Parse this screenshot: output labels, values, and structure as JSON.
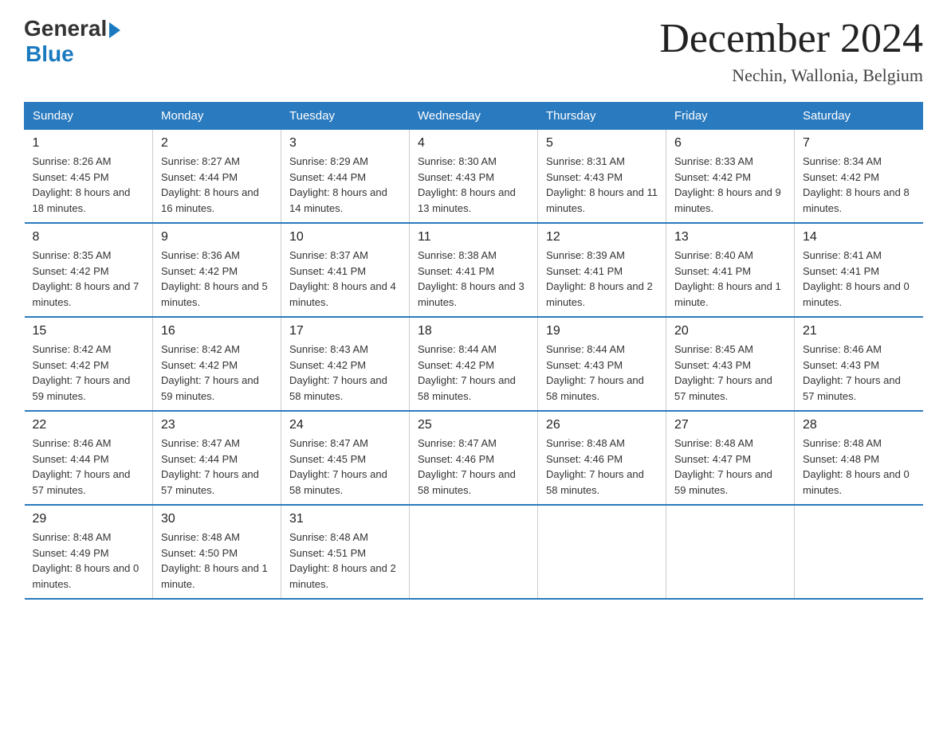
{
  "logo": {
    "general": "General",
    "blue": "Blue"
  },
  "title": {
    "month": "December 2024",
    "location": "Nechin, Wallonia, Belgium"
  },
  "days_of_week": [
    "Sunday",
    "Monday",
    "Tuesday",
    "Wednesday",
    "Thursday",
    "Friday",
    "Saturday"
  ],
  "weeks": [
    [
      {
        "day": "1",
        "sunrise": "8:26 AM",
        "sunset": "4:45 PM",
        "daylight": "8 hours and 18 minutes."
      },
      {
        "day": "2",
        "sunrise": "8:27 AM",
        "sunset": "4:44 PM",
        "daylight": "8 hours and 16 minutes."
      },
      {
        "day": "3",
        "sunrise": "8:29 AM",
        "sunset": "4:44 PM",
        "daylight": "8 hours and 14 minutes."
      },
      {
        "day": "4",
        "sunrise": "8:30 AM",
        "sunset": "4:43 PM",
        "daylight": "8 hours and 13 minutes."
      },
      {
        "day": "5",
        "sunrise": "8:31 AM",
        "sunset": "4:43 PM",
        "daylight": "8 hours and 11 minutes."
      },
      {
        "day": "6",
        "sunrise": "8:33 AM",
        "sunset": "4:42 PM",
        "daylight": "8 hours and 9 minutes."
      },
      {
        "day": "7",
        "sunrise": "8:34 AM",
        "sunset": "4:42 PM",
        "daylight": "8 hours and 8 minutes."
      }
    ],
    [
      {
        "day": "8",
        "sunrise": "8:35 AM",
        "sunset": "4:42 PM",
        "daylight": "8 hours and 7 minutes."
      },
      {
        "day": "9",
        "sunrise": "8:36 AM",
        "sunset": "4:42 PM",
        "daylight": "8 hours and 5 minutes."
      },
      {
        "day": "10",
        "sunrise": "8:37 AM",
        "sunset": "4:41 PM",
        "daylight": "8 hours and 4 minutes."
      },
      {
        "day": "11",
        "sunrise": "8:38 AM",
        "sunset": "4:41 PM",
        "daylight": "8 hours and 3 minutes."
      },
      {
        "day": "12",
        "sunrise": "8:39 AM",
        "sunset": "4:41 PM",
        "daylight": "8 hours and 2 minutes."
      },
      {
        "day": "13",
        "sunrise": "8:40 AM",
        "sunset": "4:41 PM",
        "daylight": "8 hours and 1 minute."
      },
      {
        "day": "14",
        "sunrise": "8:41 AM",
        "sunset": "4:41 PM",
        "daylight": "8 hours and 0 minutes."
      }
    ],
    [
      {
        "day": "15",
        "sunrise": "8:42 AM",
        "sunset": "4:42 PM",
        "daylight": "7 hours and 59 minutes."
      },
      {
        "day": "16",
        "sunrise": "8:42 AM",
        "sunset": "4:42 PM",
        "daylight": "7 hours and 59 minutes."
      },
      {
        "day": "17",
        "sunrise": "8:43 AM",
        "sunset": "4:42 PM",
        "daylight": "7 hours and 58 minutes."
      },
      {
        "day": "18",
        "sunrise": "8:44 AM",
        "sunset": "4:42 PM",
        "daylight": "7 hours and 58 minutes."
      },
      {
        "day": "19",
        "sunrise": "8:44 AM",
        "sunset": "4:43 PM",
        "daylight": "7 hours and 58 minutes."
      },
      {
        "day": "20",
        "sunrise": "8:45 AM",
        "sunset": "4:43 PM",
        "daylight": "7 hours and 57 minutes."
      },
      {
        "day": "21",
        "sunrise": "8:46 AM",
        "sunset": "4:43 PM",
        "daylight": "7 hours and 57 minutes."
      }
    ],
    [
      {
        "day": "22",
        "sunrise": "8:46 AM",
        "sunset": "4:44 PM",
        "daylight": "7 hours and 57 minutes."
      },
      {
        "day": "23",
        "sunrise": "8:47 AM",
        "sunset": "4:44 PM",
        "daylight": "7 hours and 57 minutes."
      },
      {
        "day": "24",
        "sunrise": "8:47 AM",
        "sunset": "4:45 PM",
        "daylight": "7 hours and 58 minutes."
      },
      {
        "day": "25",
        "sunrise": "8:47 AM",
        "sunset": "4:46 PM",
        "daylight": "7 hours and 58 minutes."
      },
      {
        "day": "26",
        "sunrise": "8:48 AM",
        "sunset": "4:46 PM",
        "daylight": "7 hours and 58 minutes."
      },
      {
        "day": "27",
        "sunrise": "8:48 AM",
        "sunset": "4:47 PM",
        "daylight": "7 hours and 59 minutes."
      },
      {
        "day": "28",
        "sunrise": "8:48 AM",
        "sunset": "4:48 PM",
        "daylight": "8 hours and 0 minutes."
      }
    ],
    [
      {
        "day": "29",
        "sunrise": "8:48 AM",
        "sunset": "4:49 PM",
        "daylight": "8 hours and 0 minutes."
      },
      {
        "day": "30",
        "sunrise": "8:48 AM",
        "sunset": "4:50 PM",
        "daylight": "8 hours and 1 minute."
      },
      {
        "day": "31",
        "sunrise": "8:48 AM",
        "sunset": "4:51 PM",
        "daylight": "8 hours and 2 minutes."
      },
      null,
      null,
      null,
      null
    ]
  ],
  "labels": {
    "sunrise": "Sunrise:",
    "sunset": "Sunset:",
    "daylight": "Daylight:"
  }
}
